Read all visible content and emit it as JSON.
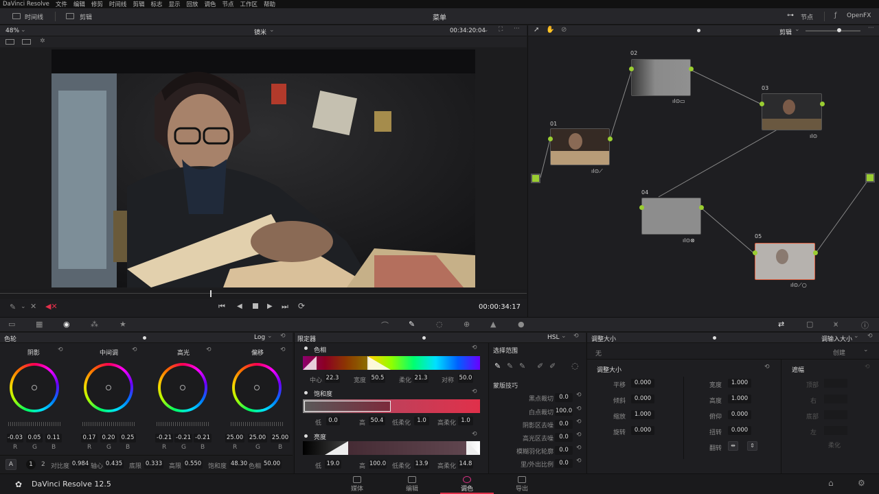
{
  "menu": [
    "DaVinci Resolve",
    "文件",
    "编辑",
    "修剪",
    "时间线",
    "剪辑",
    "标志",
    "显示",
    "回放",
    "调色",
    "节点",
    "工作区",
    "帮助"
  ],
  "title": {
    "timeline": "时间线",
    "clips": "剪辑",
    "center": "菜单",
    "nodes": "节点",
    "openfx": "OpenFX"
  },
  "viewer": {
    "zoom": "48%",
    "clip_name": "镜米",
    "timecode_top": "00:34:20:04",
    "timecode_bottom": "00:00:34:17"
  },
  "node_panel": {
    "mode": "剪辑",
    "nodes": [
      {
        "id": "01"
      },
      {
        "id": "02"
      },
      {
        "id": "03"
      },
      {
        "id": "04"
      },
      {
        "id": "05"
      }
    ]
  },
  "colorwheels": {
    "title": "色轮",
    "mode": "Log",
    "wheels": [
      {
        "name": "阴影",
        "vals": [
          "-0.03",
          "0.05",
          "0.11"
        ]
      },
      {
        "name": "中间调",
        "vals": [
          "0.17",
          "0.20",
          "0.25"
        ]
      },
      {
        "name": "高光",
        "vals": [
          "-0.21",
          "-0.21",
          "-0.21"
        ]
      },
      {
        "name": "偏移",
        "vals": [
          "25.00",
          "25.00",
          "25.00"
        ]
      }
    ],
    "rgb": [
      "R",
      "G",
      "B"
    ],
    "bottom": {
      "a": "A",
      "p1": "1",
      "p2": "2",
      "contrast_l": "对比度",
      "contrast": "0.984",
      "pivot_l": "轴心",
      "pivot": "0.435",
      "low_l": "底限",
      "low": "0.333",
      "high_l": "高限",
      "high": "0.550",
      "sat_l": "饱和度",
      "sat": "48.30",
      "hue_l": "色相",
      "hue": "50.00"
    }
  },
  "qualifier": {
    "title": "限定器",
    "mode": "HSL",
    "hue": {
      "label": "色相",
      "center_l": "中心",
      "center": "22.3",
      "width_l": "宽度",
      "width": "50.5",
      "soft_l": "柔化",
      "soft": "21.3",
      "sym_l": "对称",
      "sym": "50.0"
    },
    "sat": {
      "label": "饱和度",
      "low_l": "低",
      "low": "0.0",
      "high_l": "高",
      "high": "50.4",
      "ls_l": "低柔化",
      "ls": "1.0",
      "hs_l": "高柔化",
      "hs": "1.0"
    },
    "lum": {
      "label": "亮度",
      "low_l": "低",
      "low": "19.0",
      "high_l": "高",
      "high": "100.0",
      "ls_l": "低柔化",
      "ls": "13.9",
      "hs_l": "高柔化",
      "hs": "14.8"
    }
  },
  "selection": {
    "title": "选择范围",
    "matte_title": "蒙版技巧",
    "rows": [
      {
        "label": "黑点裁切",
        "val": "0.0"
      },
      {
        "label": "白点裁切",
        "val": "100.0"
      },
      {
        "label": "阴影区去噪",
        "val": "0.0"
      },
      {
        "label": "高光区去噪",
        "val": "0.0"
      },
      {
        "label": "模糊羽化轮廓",
        "val": "0.0"
      },
      {
        "label": "里/外出比例",
        "val": "0.0"
      }
    ]
  },
  "sizing": {
    "title": "调整大小",
    "mode": "调输入大小",
    "none": "无",
    "create": "创建",
    "section": "调整大小",
    "shake": "遮幅",
    "left": [
      {
        "label": "平移",
        "val": "0.000"
      },
      {
        "label": "倾斜",
        "val": "0.000"
      },
      {
        "label": "缩放",
        "val": "1.000"
      },
      {
        "label": "旋转",
        "val": "0.000"
      }
    ],
    "right": [
      {
        "label": "宽度",
        "val": "1.000"
      },
      {
        "label": "高度",
        "val": "1.000"
      },
      {
        "label": "俯仰",
        "val": "0.000"
      },
      {
        "label": "扭转",
        "val": "0.000"
      }
    ],
    "flip": "翻转",
    "shake_items": [
      "顶部",
      "右",
      "底部",
      "左",
      "柔化"
    ]
  },
  "footer": {
    "brand": "DaVinci Resolve 12.5",
    "tabs": [
      "媒体",
      "编辑",
      "调色",
      "导出"
    ]
  },
  "colors": {
    "accent": "#e0304a",
    "node_green": "#9acd32"
  }
}
